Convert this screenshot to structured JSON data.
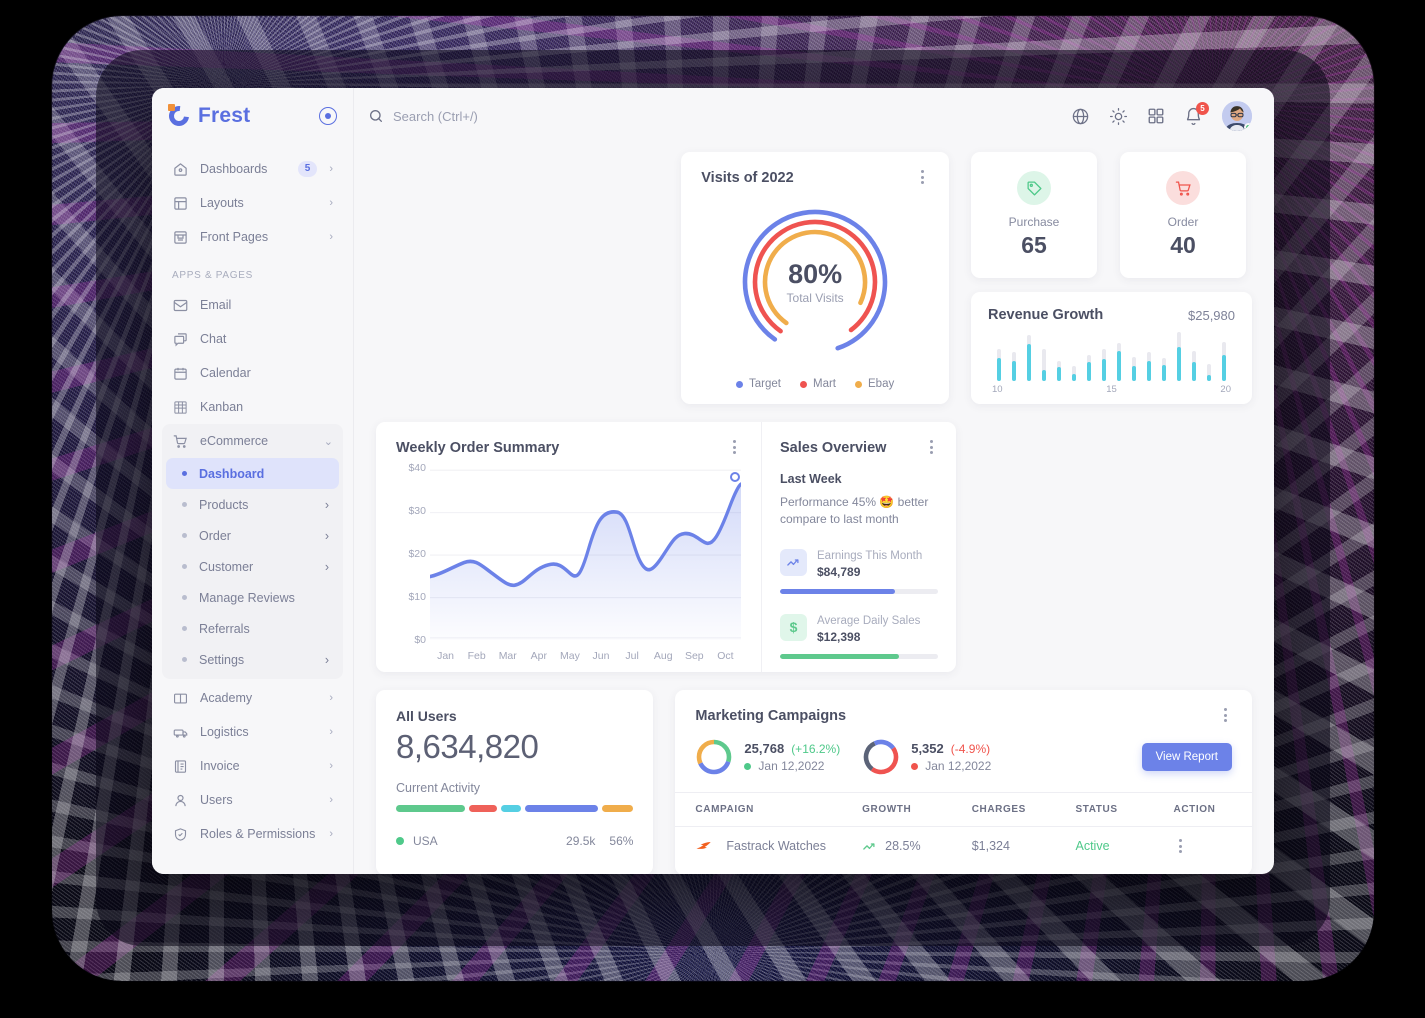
{
  "brand": {
    "name": "Frest",
    "logo_icon": "frest-logo-icon",
    "collapse_icon": "collapse-toggle-icon"
  },
  "search": {
    "placeholder": "Search (Ctrl+/)",
    "icon": "search-icon"
  },
  "topbar": {
    "icons": [
      {
        "name": "language-globe-icon",
        "glyph": "globe"
      },
      {
        "name": "theme-sun-icon",
        "glyph": "sun"
      },
      {
        "name": "apps-grid-icon",
        "glyph": "grid"
      },
      {
        "name": "notifications-bell-icon",
        "glyph": "bell",
        "badge": "5"
      }
    ],
    "avatar": {
      "name": "user-avatar",
      "status": "online"
    }
  },
  "sidebar": {
    "items": [
      {
        "label": "Dashboards",
        "icon": "home-icon",
        "badge": "5",
        "chevron": "›"
      },
      {
        "label": "Layouts",
        "icon": "layout-icon",
        "chevron": "›"
      },
      {
        "label": "Front Pages",
        "icon": "store-icon",
        "chevron": "›"
      }
    ],
    "section_label": "APPS & PAGES",
    "apps": [
      {
        "label": "Email",
        "icon": "mail-icon"
      },
      {
        "label": "Chat",
        "icon": "chat-icon"
      },
      {
        "label": "Calendar",
        "icon": "calendar-icon"
      },
      {
        "label": "Kanban",
        "icon": "kanban-icon"
      }
    ],
    "ecommerce": {
      "label": "eCommerce",
      "icon": "cart-icon",
      "chevron": "⌄",
      "children": [
        {
          "label": "Dashboard",
          "active": true,
          "chevron": ""
        },
        {
          "label": "Products",
          "chevron": "›"
        },
        {
          "label": "Order",
          "chevron": "›"
        },
        {
          "label": "Customer",
          "chevron": "›"
        },
        {
          "label": "Manage Reviews",
          "chevron": ""
        },
        {
          "label": "Referrals",
          "chevron": ""
        },
        {
          "label": "Settings",
          "chevron": "›"
        }
      ]
    },
    "bottom": [
      {
        "label": "Academy",
        "icon": "book-icon",
        "chevron": "›"
      },
      {
        "label": "Logistics",
        "icon": "truck-icon",
        "chevron": "›"
      },
      {
        "label": "Invoice",
        "icon": "invoice-icon",
        "chevron": "›"
      },
      {
        "label": "Users",
        "icon": "user-icon",
        "chevron": "›"
      },
      {
        "label": "Roles & Permissions",
        "icon": "shield-icon",
        "chevron": "›"
      }
    ]
  },
  "visits": {
    "title": "Visits of 2022",
    "center_value": "80%",
    "center_label": "Total Visits",
    "menu_icon": "kebab-menu-icon"
  },
  "stats": [
    {
      "label": "Purchase",
      "value": "65",
      "icon": "tag-icon",
      "color": "#4fc98a",
      "bg": "#ddf5e8"
    },
    {
      "label": "Order",
      "value": "40",
      "icon": "cart-icon",
      "color": "#f0544c",
      "bg": "#fbdedd"
    }
  ],
  "revenue": {
    "title": "Revenue Growth",
    "amount": "$25,980",
    "axis": [
      "10",
      "15",
      "20"
    ]
  },
  "weekly": {
    "title": "Weekly Order Summary",
    "menu_icon": "kebab-menu-icon"
  },
  "sales": {
    "title": "Sales Overview",
    "menu_icon": "kebab-menu-icon",
    "subtitle": "Last Week",
    "description": "Performance 45% 🤩 better compare to last month",
    "metrics": [
      {
        "name": "Earnings This Month",
        "value": "$84,789",
        "icon": "trend-up-icon",
        "progress": 73,
        "color": "#6c82e8",
        "bg": "#e4e9fb"
      },
      {
        "name": "Average Daily Sales",
        "value": "$12,398",
        "icon": "dollar-icon",
        "progress": 75,
        "color": "#5ec98d",
        "bg": "#e0f6ea"
      }
    ]
  },
  "all_users": {
    "title": "All Users",
    "value": "8,634,820",
    "activity_label": "Current Activity",
    "segments": [
      {
        "color": "#5ec98d",
        "pct": 31
      },
      {
        "color": "#ef6159",
        "pct": 13
      },
      {
        "color": "#55cfe3",
        "pct": 9
      },
      {
        "color": "#6c82e8",
        "pct": 33
      },
      {
        "color": "#f0ad4b",
        "pct": 14
      }
    ],
    "rows": [
      {
        "country": "USA",
        "users": "29.5k",
        "pct": "56%",
        "color": "#4fc98a"
      }
    ]
  },
  "campaigns": {
    "title": "Marketing Campaigns",
    "menu_icon": "kebab-menu-icon",
    "button": "View Report",
    "stats": [
      {
        "value": "25,768",
        "delta": "(+16.2%)",
        "delta_color": "#4fc98a",
        "date": "Jan 12,2022",
        "dot": "#4fc98a",
        "donut": [
          {
            "color": "#5ec98d",
            "pct": 30
          },
          {
            "color": "#6c82e8",
            "pct": 38
          },
          {
            "color": "#f0ad4b",
            "pct": 32
          }
        ]
      },
      {
        "value": "5,352",
        "delta": "(-4.9%)",
        "delta_color": "#f0544c",
        "date": "Jan 12,2022",
        "dot": "#f0544c",
        "donut": [
          {
            "color": "#6c82e8",
            "pct": 22
          },
          {
            "color": "#ef5350",
            "pct": 45
          },
          {
            "color": "#5b6378",
            "pct": 33
          }
        ]
      }
    ],
    "columns": [
      "CAMPAIGN",
      "GROWTH",
      "CHARGES",
      "STATUS",
      "ACTION"
    ],
    "rows": [
      {
        "campaign": "Fastrack Watches",
        "icon": "fastrack-bolt-icon",
        "growth": "28.5%",
        "growth_icon": "trend-up-icon",
        "charges": "$1,324",
        "status": "Active",
        "action_icon": "kebab-menu-icon"
      }
    ]
  },
  "chart_data": [
    {
      "type": "pie",
      "title": "Visits of 2022",
      "legend_position": "bottom",
      "center_label": "80%",
      "center_sublabel": "Total Visits",
      "series": [
        {
          "name": "Target",
          "value": 85,
          "color": "#6c82e8"
        },
        {
          "name": "Mart",
          "value": 80,
          "color": "#ef5350"
        },
        {
          "name": "Ebay",
          "value": 72,
          "color": "#f0ad4b"
        }
      ]
    },
    {
      "type": "area",
      "title": "Weekly Order Summary",
      "xlabel": "",
      "ylabel": "",
      "categories": [
        "Jan",
        "Feb",
        "Mar",
        "Apr",
        "May",
        "Jun",
        "Jul",
        "Aug",
        "Sep",
        "Oct"
      ],
      "values": [
        14.5,
        17.5,
        12.5,
        19,
        15.5,
        31,
        18,
        26,
        23,
        39
      ],
      "ytick_labels": [
        "$0",
        "$10",
        "$20",
        "$30",
        "$40"
      ],
      "ylim": [
        0,
        42
      ],
      "grid": true,
      "color": "#6c82e8"
    },
    {
      "type": "bar",
      "title": "Revenue Growth",
      "annotation": "$25,980",
      "xtick_labels": [
        "10",
        "15",
        "20"
      ],
      "categories": [
        "1",
        "2",
        "3",
        "4",
        "5",
        "6",
        "7",
        "8",
        "9",
        "10",
        "11",
        "12",
        "13",
        "14",
        "15",
        "16"
      ],
      "series": [
        {
          "name": "range-high",
          "values": [
            62,
            55,
            88,
            62,
            38,
            28,
            50,
            62,
            73,
            46,
            55,
            45,
            95,
            57,
            33,
            75
          ],
          "color": "#e9e9ef"
        },
        {
          "name": "value",
          "values": [
            44,
            38,
            72,
            22,
            26,
            14,
            36,
            42,
            58,
            28,
            38,
            30,
            66,
            36,
            12,
            50
          ],
          "color": "#55cfe3"
        }
      ],
      "ylim": [
        0,
        100
      ]
    },
    {
      "type": "bar",
      "title": "Current Activity",
      "categories": [
        "green",
        "red",
        "cyan",
        "blue",
        "orange"
      ],
      "values": [
        31,
        13,
        9,
        33,
        14
      ],
      "colors": [
        "#5ec98d",
        "#ef6159",
        "#55cfe3",
        "#6c82e8",
        "#f0ad4b"
      ]
    }
  ]
}
